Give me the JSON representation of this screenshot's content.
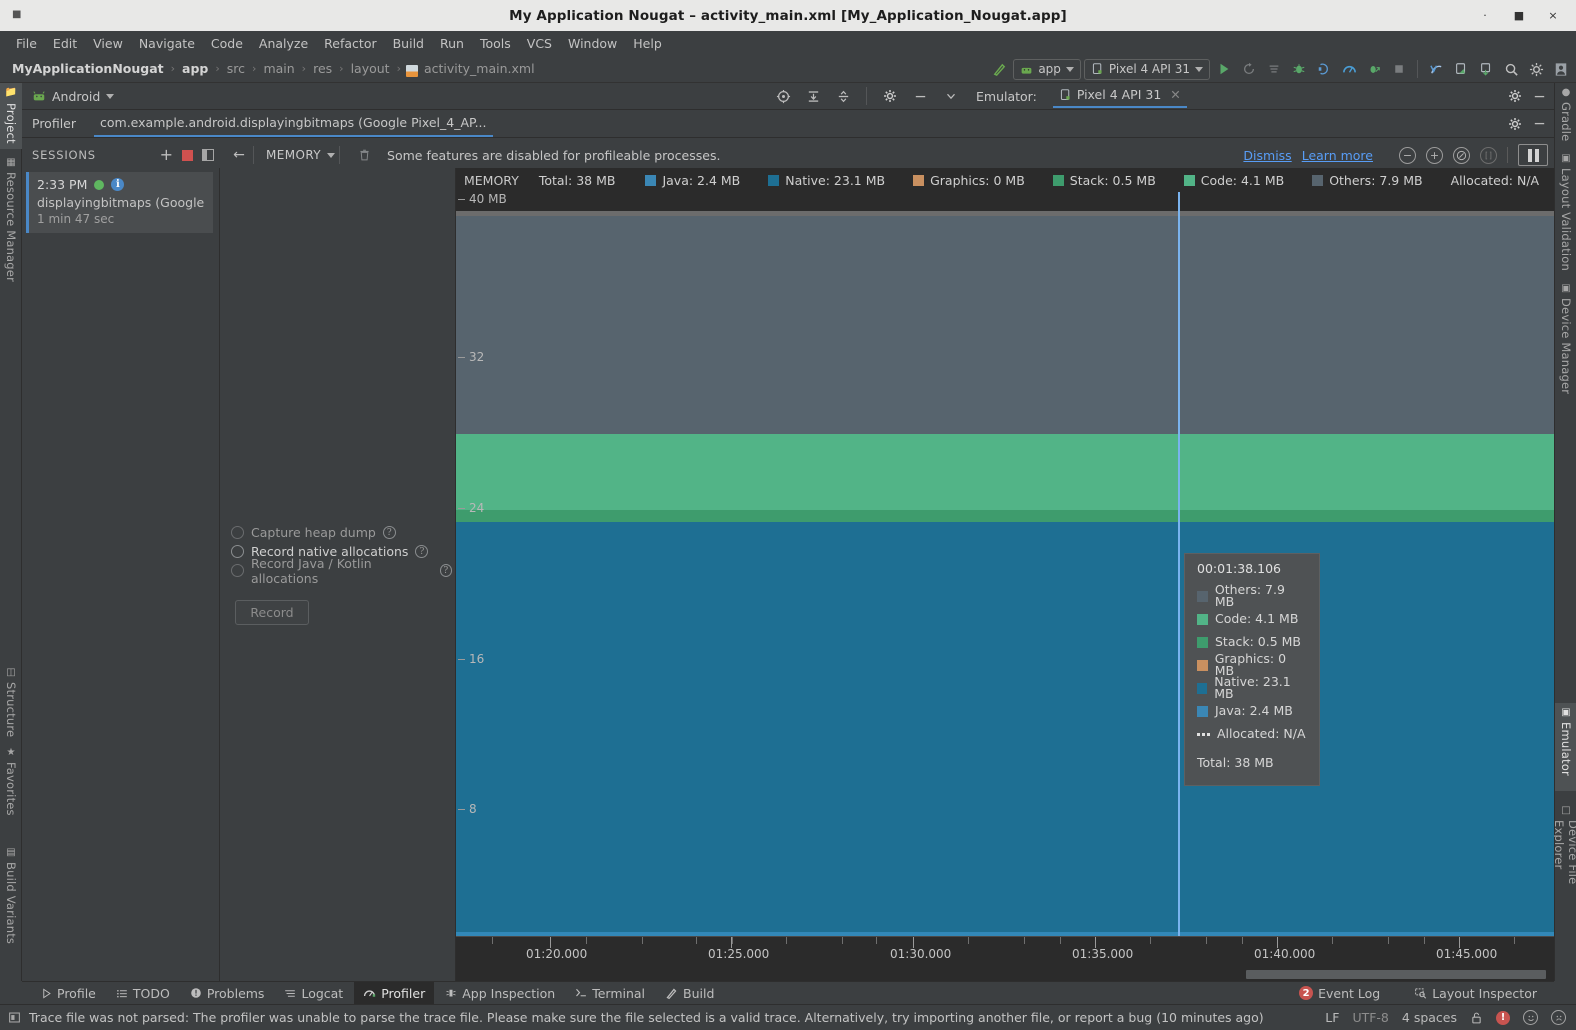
{
  "window": {
    "title": "My Application Nougat – activity_main.xml [My_Application_Nougat.app]",
    "minimize": "·",
    "maximize": "■",
    "close": "×"
  },
  "menu": {
    "items": [
      "File",
      "Edit",
      "View",
      "Navigate",
      "Code",
      "Analyze",
      "Refactor",
      "Build",
      "Run",
      "Tools",
      "VCS",
      "Window",
      "Help"
    ]
  },
  "breadcrumb": {
    "items": [
      "MyApplicationNougat",
      "app",
      "src",
      "main",
      "res",
      "layout",
      "activity_main.xml"
    ],
    "separator": "›"
  },
  "nav_toolbar": {
    "run_config": "app",
    "device": "Pixel 4 API 31",
    "icons": [
      "hammer-icon",
      "run-icon",
      "rerun-icon",
      "apply-changes-icon",
      "debug-icon",
      "debug-attach-icon",
      "profile-icon",
      "profile-arrow-icon",
      "stop-icon",
      "sync-gradle-icon",
      "avd-manager-icon",
      "sdk-manager-icon",
      "search-icon",
      "settings-icon",
      "account-icon"
    ]
  },
  "left_strip": {
    "items": [
      "Project",
      "Resource Manager",
      "Structure",
      "Favorites",
      "Build Variants"
    ],
    "active": "Project"
  },
  "right_strip": {
    "items": [
      "Gradle",
      "Layout Validation",
      "Device Manager",
      "Emulator",
      "Device File Explorer"
    ],
    "active": "Emulator"
  },
  "tool_header": {
    "title": "Android",
    "emulator_label": "Emulator:",
    "emulator_tab": "Pixel 4 API 31"
  },
  "profiler_tabs": {
    "label": "Profiler",
    "session_tab": "com.example.android.displayingbitmaps (Google Pixel_4_AP..."
  },
  "sessions": {
    "header": "SESSIONS",
    "add_label": "+",
    "items": [
      {
        "time": "2:33 PM",
        "name": "displayingbitmaps (Google Pi...",
        "duration": "1 min 47 sec"
      }
    ]
  },
  "record_panel": {
    "options": [
      {
        "label": "Capture heap dump",
        "enabled": false
      },
      {
        "label": "Record native allocations",
        "enabled": true
      },
      {
        "label": "Record Java / Kotlin allocations",
        "enabled": false
      }
    ],
    "help_glyph": "?",
    "record_button": "Record"
  },
  "memory_toolbar": {
    "back_glyph": "←",
    "mode": "MEMORY",
    "trash_glyph": "Ὕ1",
    "message": "Some features are disabled for profileable processes.",
    "dismiss": "Dismiss",
    "learn_more": "Learn more",
    "zoom_out": "−",
    "zoom_in": "+",
    "reset_zoom": "⌀",
    "attach_live": "[ ]",
    "pause": "pause-icon"
  },
  "chart_data": {
    "type": "area",
    "title": "MEMORY",
    "total_label": "Total: 38 MB",
    "allocated_label": "Allocated: N/A",
    "xlabel": "",
    "ylabel": "MB",
    "ylim": [
      0,
      40
    ],
    "yticks": [
      "40 MB",
      "32",
      "24",
      "16",
      "8"
    ],
    "ytick_values": [
      40,
      32,
      24,
      16,
      8
    ],
    "grid": false,
    "legend_position": "top",
    "xticks": [
      "01:20.000",
      "01:25.000",
      "01:30.000",
      "01:35.000",
      "01:40.000",
      "01:45.000"
    ],
    "series": [
      {
        "name": "Java",
        "value_mb": 2.4,
        "label": "Java: 2.4 MB",
        "color": "#3b87b5"
      },
      {
        "name": "Native",
        "value_mb": 23.1,
        "label": "Native: 23.1 MB",
        "color": "#1e6f93"
      },
      {
        "name": "Graphics",
        "value_mb": 0,
        "label": "Graphics: 0 MB",
        "color": "#c99060"
      },
      {
        "name": "Stack",
        "value_mb": 0.5,
        "label": "Stack: 0.5 MB",
        "color": "#3e9c6d"
      },
      {
        "name": "Code",
        "value_mb": 4.1,
        "label": "Code: 4.1 MB",
        "color": "#52b487"
      },
      {
        "name": "Others",
        "value_mb": 7.9,
        "label": "Others: 7.9 MB",
        "color": "#57646e"
      }
    ],
    "cursor_time": "00:01:38.106"
  },
  "tooltip": {
    "time": "00:01:38.106",
    "rows": [
      {
        "label": "Others: 7.9 MB",
        "color": "#57646e"
      },
      {
        "label": "Code: 4.1 MB",
        "color": "#52b487"
      },
      {
        "label": "Stack: 0.5 MB",
        "color": "#3e9c6d"
      },
      {
        "label": "Graphics: 0 MB",
        "color": "#c99060"
      },
      {
        "label": "Native: 23.1 MB",
        "color": "#1e6f93"
      },
      {
        "label": "Java: 2.4 MB",
        "color": "#3b87b5"
      },
      {
        "label": "Allocated: N/A",
        "color": "dashed"
      }
    ],
    "total": "Total: 38 MB"
  },
  "bottom_bar": {
    "tabs": [
      "Profile",
      "TODO",
      "Problems",
      "Logcat",
      "Profiler",
      "App Inspection",
      "Terminal",
      "Build"
    ],
    "active": "Profiler",
    "event_log": "Event Log",
    "event_log_count": "2",
    "layout_inspector": "Layout Inspector"
  },
  "status_bar": {
    "message": "Trace file was not parsed: The profiler was unable to parse the trace file. Please make sure the file selected is a valid trace. Alternatively, try importing another file, or report a bug (10 minutes ago)",
    "line_separator": "LF",
    "encoding": "UTF-8",
    "indent": "4 spaces",
    "lock": "lock-icon"
  },
  "colors": {
    "accent": "#4a88c7",
    "link": "#589df6",
    "chart_bg": "#2b2b2b",
    "panel_bg": "#3c3f41"
  }
}
